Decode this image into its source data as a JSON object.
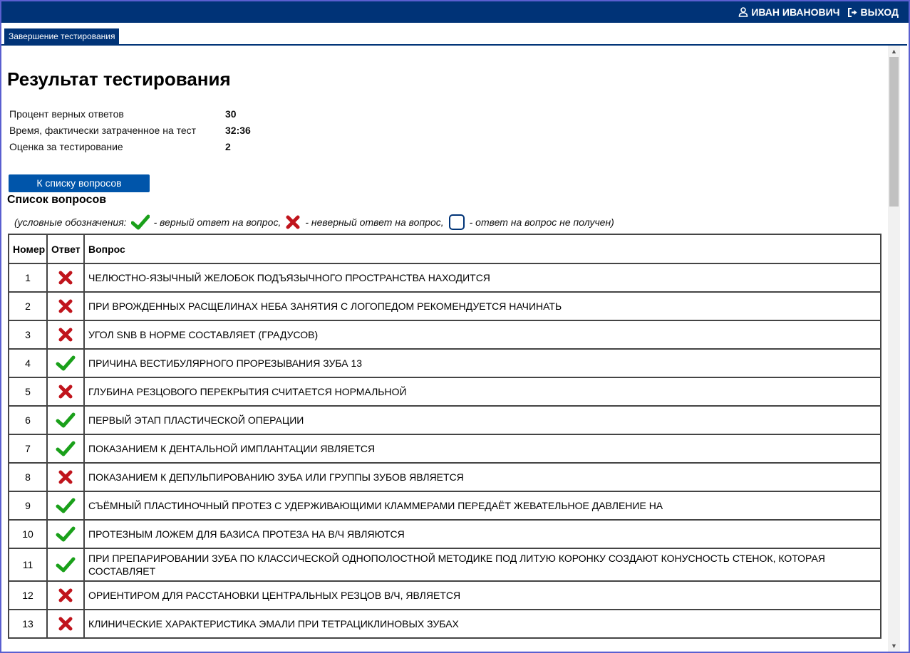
{
  "header": {
    "user_name": "ИВАН ИВАНОВИЧ",
    "logout_label": "ВЫХОД",
    "user_icon": "user-icon",
    "logout_icon": "logout-icon"
  },
  "tab": {
    "label": "Завершение тестирования"
  },
  "page": {
    "title": "Результат тестирования"
  },
  "stats": [
    {
      "label": "Процент верных ответов",
      "value": "30"
    },
    {
      "label": "Время, фактически затраченное на тест",
      "value": "32:36"
    },
    {
      "label": "Оценка за тестирование",
      "value": "2"
    }
  ],
  "questions_button": {
    "label": "К списку вопросов"
  },
  "questions_title": "Список вопросов",
  "legend": {
    "prefix": "(условные обозначения:",
    "correct": "- верный ответ на вопрос,",
    "wrong": "- неверный ответ на вопрос,",
    "none": "- ответ на вопрос не получен)"
  },
  "table": {
    "headers": [
      "Номер",
      "Ответ",
      "Вопрос"
    ],
    "rows": [
      {
        "num": "1",
        "status": "wrong",
        "question": "ЧЕЛЮСТНО-ЯЗЫЧНЫЙ ЖЕЛОБОК ПОДЪЯЗЫЧНОГО ПРОСТРАНСТВА НАХОДИТСЯ"
      },
      {
        "num": "2",
        "status": "wrong",
        "question": "ПРИ ВРОЖДЕННЫХ РАСЩЕЛИНАХ НЕБА ЗАНЯТИЯ С ЛОГОПЕДОМ РЕКОМЕНДУЕТСЯ НАЧИНАТЬ"
      },
      {
        "num": "3",
        "status": "wrong",
        "question": "УГОЛ SNB В НОРМЕ СОСТАВЛЯЕТ (ГРАДУСОВ)"
      },
      {
        "num": "4",
        "status": "correct",
        "question": "ПРИЧИНА ВЕСТИБУЛЯРНОГО ПРОРЕЗЫВАНИЯ ЗУБА 13"
      },
      {
        "num": "5",
        "status": "wrong",
        "question": "ГЛУБИНА РЕЗЦОВОГО ПЕРЕКРЫТИЯ СЧИТАЕТСЯ НОРМАЛЬНОЙ"
      },
      {
        "num": "6",
        "status": "correct",
        "question": "ПЕРВЫЙ ЭТАП ПЛАСТИЧЕСКОЙ ОПЕРАЦИИ"
      },
      {
        "num": "7",
        "status": "correct",
        "question": "ПОКАЗАНИЕМ К ДЕНТАЛЬНОЙ ИМПЛАНТАЦИИ ЯВЛЯЕТСЯ"
      },
      {
        "num": "8",
        "status": "wrong",
        "question": "ПОКАЗАНИЕМ К ДЕПУЛЬПИРОВАНИЮ ЗУБА ИЛИ ГРУППЫ ЗУБОВ ЯВЛЯЕТСЯ"
      },
      {
        "num": "9",
        "status": "correct",
        "question": "СЪЁМНЫЙ ПЛАСТИНОЧНЫЙ ПРОТЕЗ С УДЕРЖИВАЮЩИМИ КЛАММЕРАМИ ПЕРЕДАЁТ ЖЕВАТЕЛЬНОЕ ДАВЛЕНИЕ НА"
      },
      {
        "num": "10",
        "status": "correct",
        "question": "ПРОТЕЗНЫМ ЛОЖЕМ ДЛЯ БАЗИСА ПРОТЕЗА НА В/Ч ЯВЛЯЮТСЯ"
      },
      {
        "num": "11",
        "status": "correct",
        "question": "ПРИ ПРЕПАРИРОВАНИИ ЗУБА ПО КЛАССИЧЕСКОЙ ОДНОПОЛОСТНОЙ МЕТОДИКЕ ПОД ЛИТУЮ КОРОНКУ СОЗДАЮТ КОНУСНОСТЬ СТЕНОК, КОТОРАЯ СОСТАВЛЯЕТ"
      },
      {
        "num": "12",
        "status": "wrong",
        "question": "ОРИЕНТИРОМ ДЛЯ РАССТАНОВКИ ЦЕНТРАЛЬНЫХ РЕЗЦОВ В/Ч, ЯВЛЯЕТСЯ"
      },
      {
        "num": "13",
        "status": "wrong",
        "question": "КЛИНИЧЕСКИЕ ХАРАКТЕРИСТИКА ЭМАЛИ ПРИ ТЕТРАЦИКЛИНОВЫХ ЗУБАХ"
      }
    ]
  },
  "colors": {
    "header_bg": "#003377",
    "button_bg": "#0055aa",
    "correct": "#1aa01a",
    "wrong": "#c0141c",
    "none": "#003377"
  }
}
